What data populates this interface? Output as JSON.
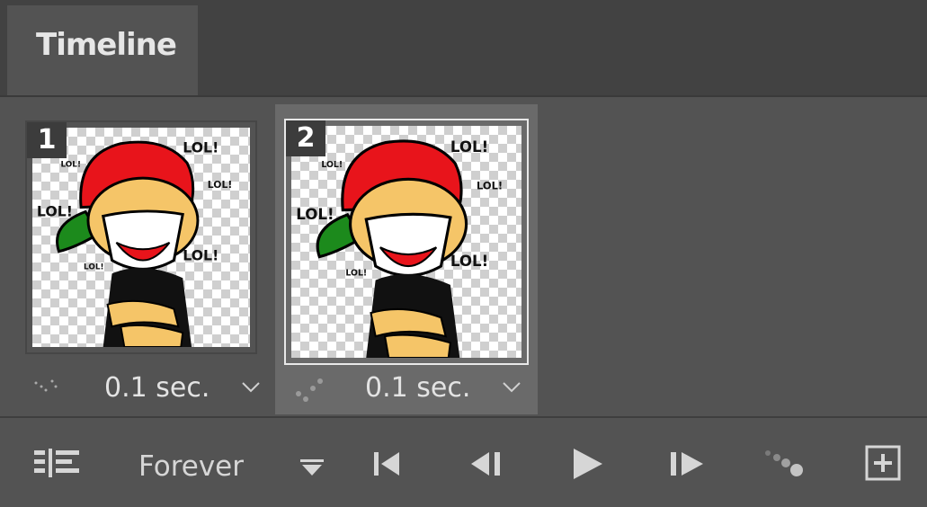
{
  "panel": {
    "title": "Timeline"
  },
  "frames": [
    {
      "number": "1",
      "delay": "0.1 sec.",
      "selected": false
    },
    {
      "number": "2",
      "delay": "0.1 sec.",
      "selected": true
    }
  ],
  "controls": {
    "loop_option": "Forever",
    "icons": [
      "convert-timeline-icon",
      "loop-dropdown-icon",
      "first-frame-icon",
      "previous-frame-icon",
      "play-icon",
      "next-frame-icon",
      "tween-icon",
      "duplicate-frame-icon"
    ]
  },
  "colors": {
    "panel_bg": "#535353",
    "tab_bar_bg": "#424242",
    "selected_frame_bg": "#6a6a6a"
  }
}
